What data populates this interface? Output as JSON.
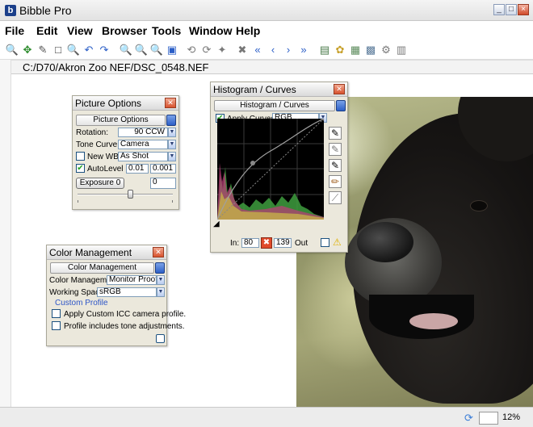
{
  "app": {
    "title": "Bibble Pro",
    "logo_letter": "b"
  },
  "window_controls": {
    "minimize": "_",
    "maximize": "□",
    "close": "×"
  },
  "menu": [
    "File",
    "Edit",
    "View",
    "Browser",
    "Tools",
    "Window",
    "Help"
  ],
  "toolbar_icons": [
    {
      "name": "zoom-icon",
      "glyph": "🔍"
    },
    {
      "name": "move-icon",
      "glyph": "✥"
    },
    {
      "name": "eyedropper-icon",
      "glyph": "✎"
    },
    {
      "name": "crop-icon",
      "glyph": "□"
    },
    {
      "name": "magnify-icon",
      "glyph": "🔍"
    },
    {
      "name": "undo-icon",
      "glyph": "↶"
    },
    {
      "name": "redo-icon",
      "glyph": "↷"
    },
    {
      "name": "zoom-in-icon",
      "glyph": "🔍"
    },
    {
      "name": "zoom-out-icon",
      "glyph": "🔍"
    },
    {
      "name": "zoom-fit-icon",
      "glyph": "🔍"
    },
    {
      "name": "fit-window-icon",
      "glyph": "▣"
    },
    {
      "name": "rotate-left-icon",
      "glyph": "⟲"
    },
    {
      "name": "rotate-right-icon",
      "glyph": "⟳"
    },
    {
      "name": "stamp-icon",
      "glyph": "✦"
    },
    {
      "name": "delete-icon",
      "glyph": "✖"
    },
    {
      "name": "first-icon",
      "glyph": "«"
    },
    {
      "name": "previous-icon",
      "glyph": "‹"
    },
    {
      "name": "next-icon",
      "glyph": "›"
    },
    {
      "name": "last-icon",
      "glyph": "»"
    },
    {
      "name": "view-mode-icon",
      "glyph": "▤"
    },
    {
      "name": "tag-icon",
      "glyph": "✿"
    },
    {
      "name": "grid-icon",
      "glyph": "▦"
    },
    {
      "name": "image-icon",
      "glyph": "▩"
    },
    {
      "name": "tools-icon",
      "glyph": "⚙"
    },
    {
      "name": "calendar-icon",
      "glyph": "▥"
    }
  ],
  "path": "C:/D70/Akron Zoo NEF/DSC_0548.NEF",
  "picture_options": {
    "title": "Picture Options",
    "header": "Picture Options",
    "rotation_label": "Rotation:",
    "rotation_value": "90 CCW",
    "tone_curve_label": "Tone Curve:",
    "tone_curve_value": "Camera",
    "new_wb_label": "New WB",
    "new_wb_value": "As Shot",
    "autolevel_label": "AutoLevel",
    "autolevel_low": "0.01",
    "autolevel_high": "0.001",
    "exposure_label": "Exposure 0",
    "exposure_value": "0",
    "slider_level": 0.55
  },
  "histogram": {
    "title": "Histogram / Curves",
    "header": "Histogram / Curves",
    "apply_curves_label": "Apply Curves",
    "channel": "RGB",
    "in_label": "In:",
    "in_value": "80",
    "out_value": "139",
    "out_label": "Out"
  },
  "color_management": {
    "title": "Color Management",
    "header": "Color Management",
    "cm_label": "Color Management:",
    "cm_value": "Monitor Proofed",
    "ws_label": "Working Space:",
    "ws_value": "sRGB",
    "custom_profile_label": "Custom Profile",
    "apply_icc_label": "Apply Custom ICC camera profile.",
    "profile_tone_label": "Profile includes tone adjustments."
  },
  "status": {
    "zoom": "12%"
  },
  "colors": {
    "accent": "#2c5fc7",
    "close_red": "#d8532f",
    "check_green": "#21a121"
  }
}
